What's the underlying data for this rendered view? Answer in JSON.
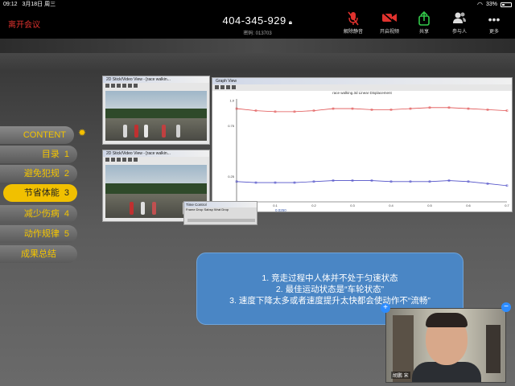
{
  "status_bar": {
    "time": "09:12",
    "date": "3月18日 周三",
    "battery": "33%",
    "wifi_icon": "wifi-icon",
    "battery_icon": "battery-icon"
  },
  "meeting": {
    "leave_label": "离开会议",
    "meeting_id": "404-345-929",
    "password_text": "密码: 013703",
    "toolbar": {
      "mute_label": "解除静音",
      "video_label": "开启视频",
      "share_label": "共享",
      "participants_label": "参与人",
      "more_label": "更多"
    }
  },
  "slide": {
    "nav": {
      "header": "CONTENT",
      "items": [
        {
          "label": "目录",
          "num": "1"
        },
        {
          "label": "避免犯规",
          "num": "2"
        },
        {
          "label": "节省体能",
          "num": "3"
        },
        {
          "label": "减少伤病",
          "num": "4"
        },
        {
          "label": "动作规律",
          "num": "5"
        },
        {
          "label": "成果总结",
          "num": ""
        }
      ],
      "active_index": 2,
      "accent_color": "#f1c000"
    },
    "software": {
      "video1_title": "2D Stick/Video View - [race walkin...",
      "video2_title": "2D Stick/Video View - [race walkin...",
      "graph_window_title": "Graph View",
      "graph_title": "race walking.3d Linear Displacement",
      "control_title": "Time Control",
      "control_headers": "Frame   Drop     Sabsp    Wrat     Drop",
      "graph_readout": "0.0250"
    },
    "chart_data": {
      "type": "line",
      "title": "race walking.3d Linear Displacement",
      "x": [
        0,
        0.05,
        0.1,
        0.15,
        0.2,
        0.25,
        0.3,
        0.35,
        0.4,
        0.45,
        0.5,
        0.55,
        0.6,
        0.65,
        0.7
      ],
      "x_ticks": [
        "0.1",
        "0.2",
        "0.3",
        "0.4",
        "0.5",
        "0.6",
        "0.7",
        "Sec"
      ],
      "y_ticks": [
        "1.0",
        "0.75",
        "0.25",
        "0"
      ],
      "series": [
        {
          "color": "#e05050",
          "values": [
            0.92,
            0.9,
            0.89,
            0.89,
            0.9,
            0.92,
            0.92,
            0.91,
            0.91,
            0.92,
            0.93,
            0.93,
            0.92,
            0.91,
            0.9
          ]
        },
        {
          "color": "#5050c8",
          "values": [
            0.2,
            0.19,
            0.19,
            0.19,
            0.2,
            0.21,
            0.21,
            0.21,
            0.2,
            0.2,
            0.2,
            0.21,
            0.2,
            0.18,
            0.16
          ]
        }
      ],
      "xlim": [
        0,
        0.7
      ],
      "ylim": [
        0,
        1.0
      ],
      "xlabel": "",
      "ylabel": ""
    },
    "callout": {
      "lines": [
        "1.   竞走过程中人体并不处于匀速状态",
        "2.   最佳运动状态是“车轮状态”",
        "3.   速度下降太多或者速度提升太快都会使动作不“流畅”"
      ],
      "bg_color": "#4a86c5"
    }
  },
  "self_video": {
    "name": "胡鹏 宋"
  }
}
